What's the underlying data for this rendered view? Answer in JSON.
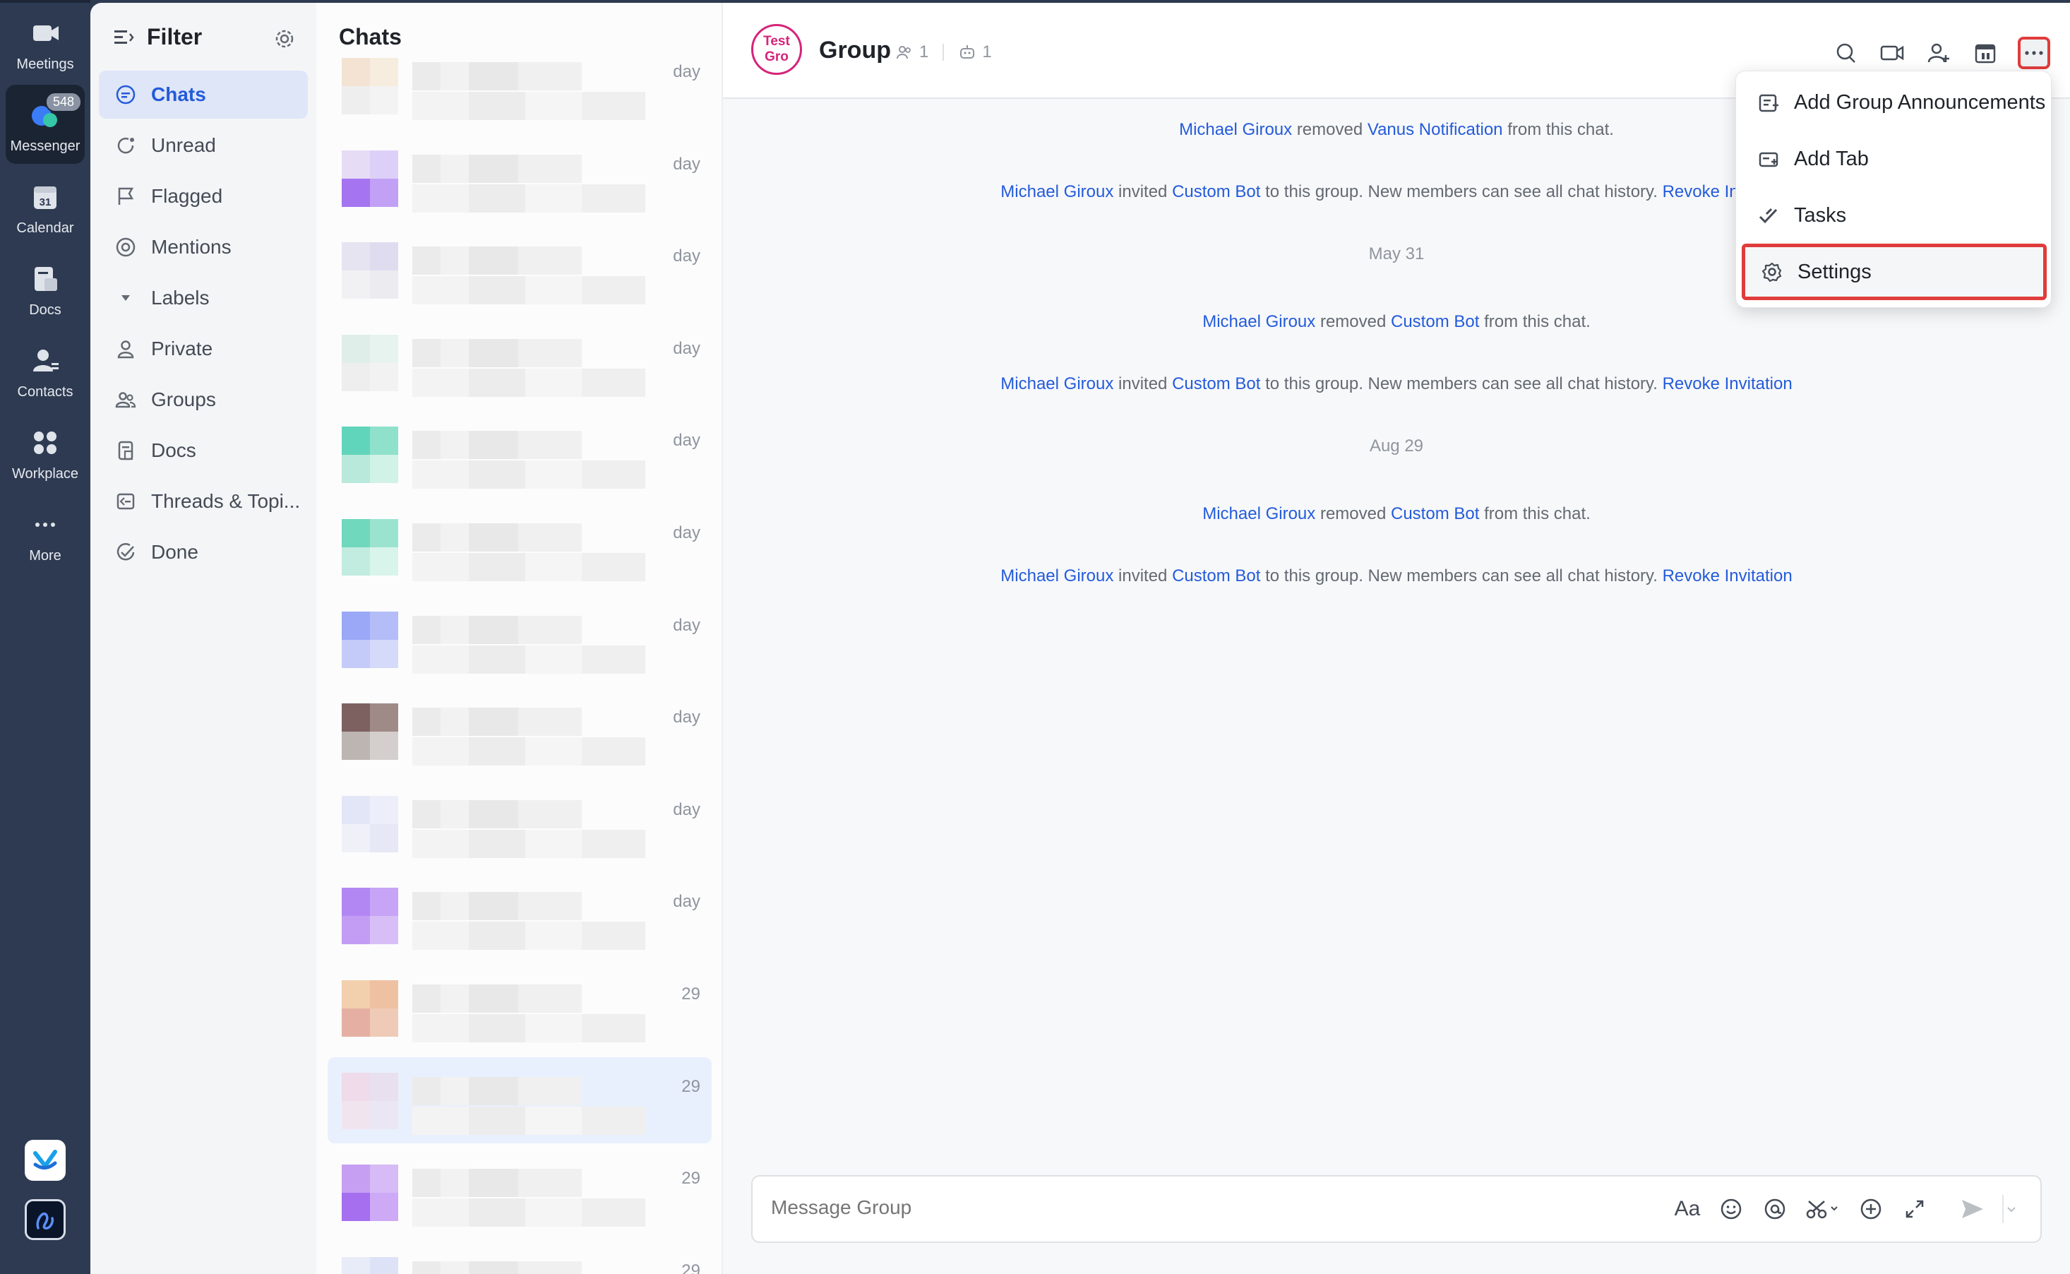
{
  "rail": {
    "items": [
      {
        "label": "Meetings",
        "icon": "video-camera-icon"
      },
      {
        "label": "Messenger",
        "icon": "chat-bubble-icon",
        "badge": "548"
      },
      {
        "label": "Calendar",
        "icon": "calendar-icon",
        "date": "31"
      },
      {
        "label": "Docs",
        "icon": "docs-icon"
      },
      {
        "label": "Contacts",
        "icon": "contacts-icon"
      },
      {
        "label": "Workplace",
        "icon": "workplace-icon"
      },
      {
        "label": "More",
        "icon": "more-dots-icon"
      }
    ]
  },
  "filter": {
    "title": "Filter",
    "items": [
      {
        "label": "Chats",
        "icon": "chat-icon"
      },
      {
        "label": "Unread",
        "icon": "unread-icon"
      },
      {
        "label": "Flagged",
        "icon": "flag-icon"
      },
      {
        "label": "Mentions",
        "icon": "at-icon"
      },
      {
        "label": "Labels",
        "icon": "caret-down-icon"
      },
      {
        "label": "Private",
        "icon": "person-icon"
      },
      {
        "label": "Groups",
        "icon": "groups-icon"
      },
      {
        "label": "Docs",
        "icon": "doc-icon"
      },
      {
        "label": "Threads & Topi...",
        "icon": "threads-icon"
      },
      {
        "label": "Done",
        "icon": "done-icon"
      }
    ]
  },
  "chatlist": {
    "title": "Chats",
    "times": [
      "day",
      "day",
      "day",
      "day",
      "day",
      "day",
      "day",
      "day",
      "day",
      "day",
      "29",
      "29",
      "29",
      "29"
    ]
  },
  "header": {
    "avatar_line1": "Test",
    "avatar_line2": "Gro",
    "title": "Group",
    "members": "1",
    "bots": "1"
  },
  "messages": [
    {
      "actor": "Michael Giroux",
      "verb": "removed",
      "target": "Vanus Notification",
      "rest": "from this chat.",
      "link": ""
    },
    {
      "actor": "Michael Giroux",
      "verb": "invited",
      "target": "Custom Bot",
      "rest": "to this group. New members can see all chat history.",
      "link": "Revoke Invitation"
    },
    {
      "date": "May 31"
    },
    {
      "actor": "Michael Giroux",
      "verb": "removed",
      "target": "Custom Bot",
      "rest": "from this chat.",
      "link": ""
    },
    {
      "actor": "Michael Giroux",
      "verb": "invited",
      "target": "Custom Bot",
      "rest": "to this group. New members can see all chat history.",
      "link": "Revoke Invitation"
    },
    {
      "date": "Aug 29"
    },
    {
      "actor": "Michael Giroux",
      "verb": "removed",
      "target": "Custom Bot",
      "rest": "from this chat.",
      "link": ""
    },
    {
      "actor": "Michael Giroux",
      "verb": "invited",
      "target": "Custom Bot",
      "rest": "to this group. New members can see all chat history.",
      "link": "Revoke Invitation"
    }
  ],
  "composer": {
    "placeholder": "Message Group",
    "text_format_label": "Aa"
  },
  "menu": {
    "items": [
      {
        "label": "Add Group Announcements",
        "icon": "announcement-icon"
      },
      {
        "label": "Add Tab",
        "icon": "add-tab-icon"
      },
      {
        "label": "Tasks",
        "icon": "tasks-icon"
      },
      {
        "label": "Settings",
        "icon": "gear-icon"
      }
    ]
  },
  "colors": {
    "accent": "#245bdb",
    "highlight": "#e03c3c",
    "avatar": "#d6247a"
  }
}
